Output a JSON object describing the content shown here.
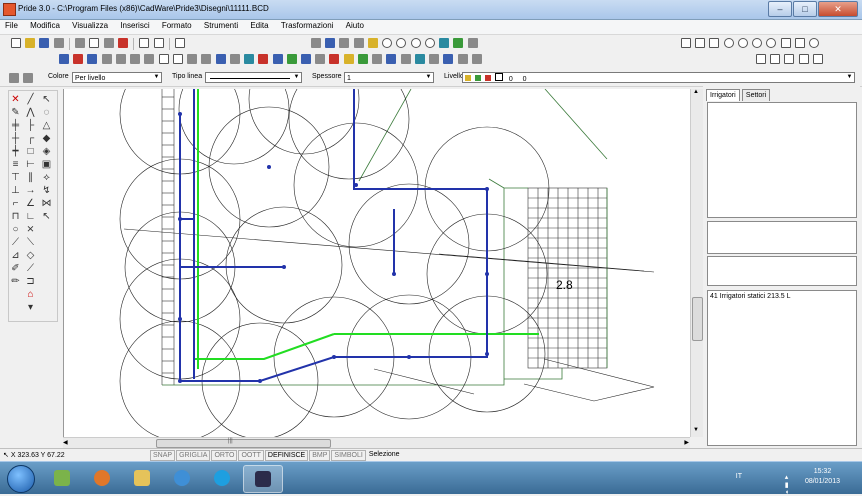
{
  "window": {
    "title": "Pride 3.0 - C:\\Program Files (x86)\\CadWare\\Pride3\\Disegni\\11111.BCD",
    "buttons": {
      "minimize": "–",
      "maximize": "□",
      "close": "✕"
    }
  },
  "menu": [
    "File",
    "Modifica",
    "Visualizza",
    "Inserisci",
    "Formato",
    "Strumenti",
    "Edita",
    "Trasformazioni",
    "Aiuto"
  ],
  "properties": {
    "color_label": "Colore",
    "color_value": "Per livello",
    "linetype_label": "Tipo linea",
    "linetype_value": "",
    "thickness_label": "Spessore",
    "thickness_value": "1",
    "layer_label": "Livello",
    "layer_values": [
      "0",
      "0"
    ]
  },
  "drawing": {
    "area_label": "2.8"
  },
  "side_panel": {
    "tabs": [
      "Irrigatori",
      "Settori"
    ],
    "summary": "41 Irrigatori statici 213.5 L"
  },
  "status": {
    "coordinates": "X 323.63 Y 67.22",
    "flags": [
      "SNAP",
      "GRIGLIA",
      "ORTO",
      "OOTT",
      "DEFINISCE",
      "BMP",
      "SIMBOLI"
    ],
    "active_flags": [
      "DEFINISCE"
    ],
    "mode": "Selezione"
  },
  "taskbar": {
    "language": "IT",
    "time": "15:32",
    "date": "08/01/2013",
    "active_app": "Pride"
  },
  "colors": {
    "pipe_blue": "#2233aa",
    "pipe_green": "#22dd22",
    "boundary_green": "#3a7a3a"
  }
}
